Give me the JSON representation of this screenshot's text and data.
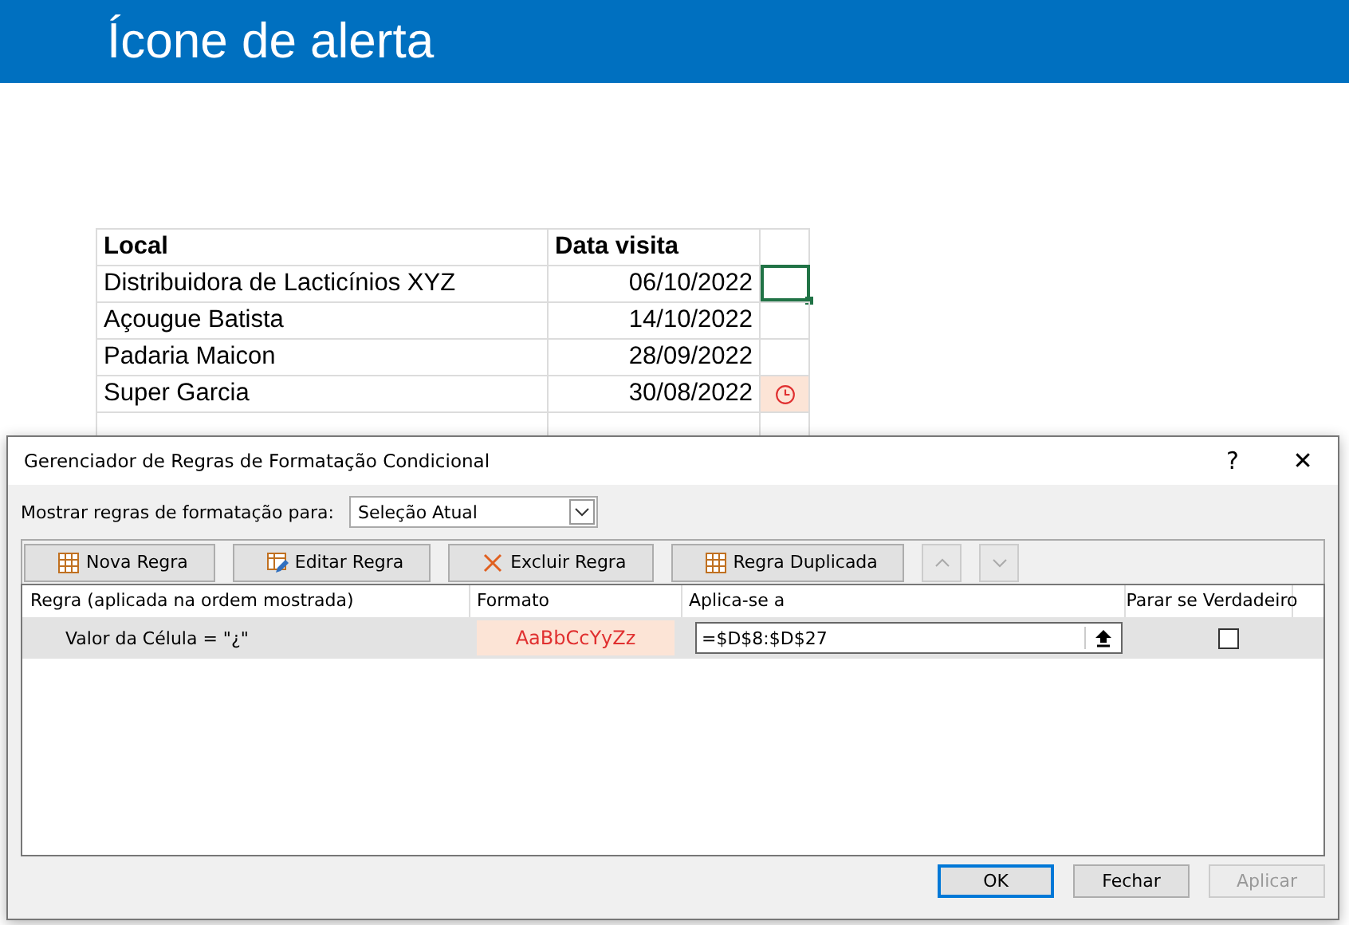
{
  "header": {
    "title": "Ícone de alerta"
  },
  "sheet": {
    "columns": [
      "Local",
      "Data visita"
    ],
    "rows": [
      {
        "local": "Distribuidora de Lacticínios XYZ",
        "date": "06/10/2022",
        "alert": false,
        "selected": true
      },
      {
        "local": "Açougue Batista",
        "date": "14/10/2022",
        "alert": false,
        "selected": false
      },
      {
        "local": "Padaria Maicon",
        "date": "28/09/2022",
        "alert": false,
        "selected": false
      },
      {
        "local": "Super Garcia",
        "date": "30/08/2022",
        "alert": true,
        "selected": false
      }
    ]
  },
  "dialog": {
    "title": "Gerenciador de Regras de Formatação Condicional",
    "help": "?",
    "close": "✕",
    "show_label": "Mostrar regras de formatação para:",
    "show_value": "Seleção Atual",
    "toolbar": [
      {
        "label": "Nova Regra",
        "kind": "new"
      },
      {
        "label": "Editar Regra",
        "kind": "edit"
      },
      {
        "label": "Excluir Regra",
        "kind": "delete"
      },
      {
        "label": "Regra Duplicada",
        "kind": "duplicate"
      }
    ],
    "columns": [
      "Regra (aplicada na ordem mostrada)",
      "Formato",
      "Aplica-se a",
      "Parar se Verdadeiro"
    ],
    "rules": [
      {
        "rule": "Valor da Célula = \"¿\"",
        "format": "AaBbCcYyZz",
        "applies": "=$D$8:$D$27",
        "stop": false,
        "selected": true
      }
    ],
    "buttons": [
      {
        "label": "OK",
        "kind": "default",
        "disabled": false
      },
      {
        "label": "Fechar",
        "kind": "normal",
        "disabled": false
      },
      {
        "label": "Aplicar",
        "kind": "normal",
        "disabled": true
      }
    ]
  }
}
